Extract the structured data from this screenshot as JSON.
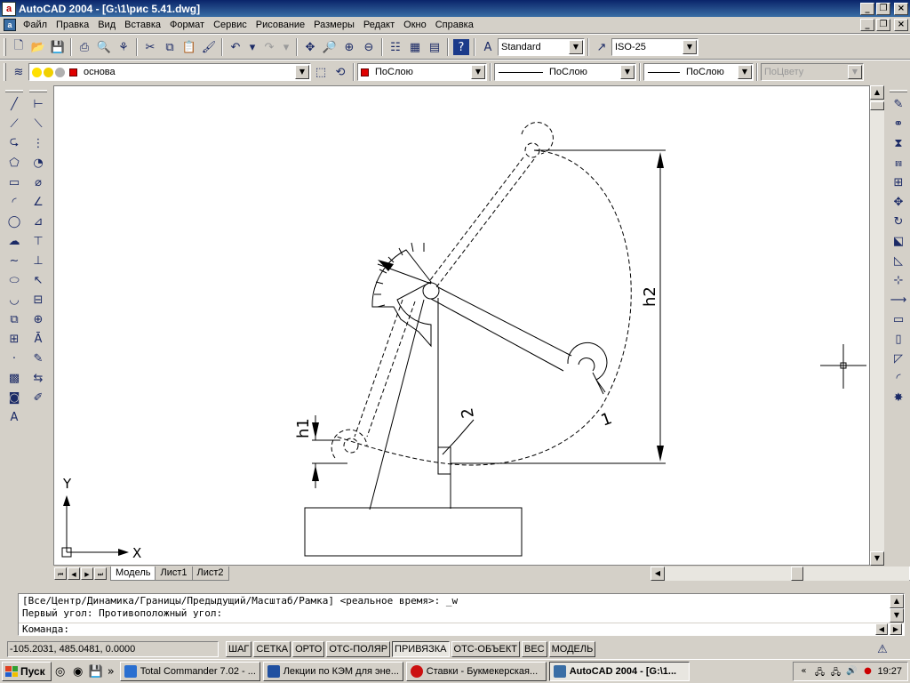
{
  "window": {
    "title": "AutoCAD 2004 - [G:\\1\\рис 5.41.dwg]",
    "app_icon_letter": "a",
    "controls": {
      "minimize": "_",
      "restore": "❐",
      "close": "×"
    }
  },
  "menu": {
    "doc_icon_letter": "a",
    "items": [
      "Файл",
      "Правка",
      "Вид",
      "Вставка",
      "Формат",
      "Сервис",
      "Рисование",
      "Размеры",
      "Редакт",
      "Окно",
      "Справка"
    ]
  },
  "toolbar_standard": {
    "text_style": "Standard",
    "dim_style": "ISO-25"
  },
  "toolbar_layers": {
    "layer_name": "основа",
    "color": "ПоСлою",
    "linetype": "ПоСлою",
    "lineweight": "ПоСлою",
    "plotstyle": "ПоЦвету"
  },
  "drawing": {
    "label_h1": "h1",
    "label_h2": "h2",
    "label_1": "1",
    "label_2": "2",
    "axis_x": "X",
    "axis_y": "Y"
  },
  "tabs": [
    "Модель",
    "Лист1",
    "Лист2"
  ],
  "command": {
    "line1": "[Все/Центр/Динамика/Границы/Предыдущий/Масштаб/Рамка] <реальное время>: _w",
    "line2": "Первый угол: Противоположный угол:",
    "prompt": "Команда:"
  },
  "status": {
    "coords": "-105.2031, 485.0481, 0.0000",
    "modes": [
      {
        "label": "ШАГ",
        "on": false
      },
      {
        "label": "СЕТКА",
        "on": false
      },
      {
        "label": "ОРТО",
        "on": false
      },
      {
        "label": "ОТС-ПОЛЯР",
        "on": false
      },
      {
        "label": "ПРИВЯЗКА",
        "on": true
      },
      {
        "label": "ОТС-ОБЪЕКТ",
        "on": false
      },
      {
        "label": "ВЕС",
        "on": false
      },
      {
        "label": "МОДЕЛЬ",
        "on": false
      }
    ]
  },
  "taskbar": {
    "start": "Пуск",
    "tasks": [
      {
        "label": "Total Commander 7.02 - ...",
        "color": "#2a6fd0",
        "active": false
      },
      {
        "label": "Лекции по КЭМ для эне...",
        "color": "#2050a0",
        "active": false
      },
      {
        "label": "Ставки - Букмекерская...",
        "color": "#cc1010",
        "active": false
      },
      {
        "label": "AutoCAD 2004 - [G:\\1...",
        "color": "#3a6ea5",
        "active": true
      }
    ],
    "time": "19:27"
  },
  "colors": {
    "title_start": "#0a246a",
    "title_end": "#3a6ea5",
    "bylayer_red": "#e00000"
  }
}
